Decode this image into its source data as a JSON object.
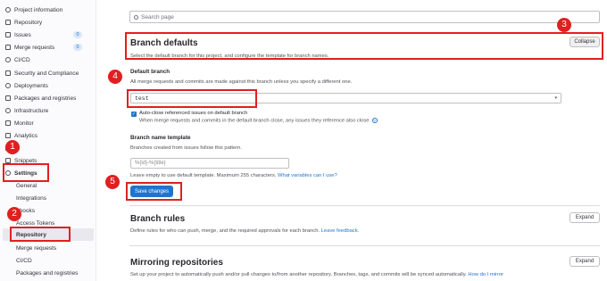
{
  "sidebar": {
    "items": [
      {
        "label": "Project information",
        "icon": "info-icon"
      },
      {
        "label": "Repository",
        "icon": "file-icon"
      },
      {
        "label": "Issues",
        "icon": "issues-icon",
        "count": "0"
      },
      {
        "label": "Merge requests",
        "icon": "merge-request-icon",
        "count": "0"
      },
      {
        "label": "CI/CD",
        "icon": "rocket-icon"
      },
      {
        "label": "Security and Compliance",
        "icon": "shield-icon"
      },
      {
        "label": "Deployments",
        "icon": "deployments-icon"
      },
      {
        "label": "Packages and registries",
        "icon": "package-icon"
      },
      {
        "label": "Infrastructure",
        "icon": "cloud-icon"
      },
      {
        "label": "Monitor",
        "icon": "monitor-icon"
      },
      {
        "label": "Analytics",
        "icon": "chart-icon"
      },
      {
        "label": "iki",
        "icon": "book-icon"
      },
      {
        "label": "Snippets",
        "icon": "snippet-icon"
      },
      {
        "label": "Settings",
        "icon": "settings-icon"
      }
    ],
    "settings_sub": [
      "General",
      "Integrations",
      "bhooks",
      "Access Tokens",
      "Repository",
      "Merge requests",
      "CI/CD",
      "Packages and registries"
    ]
  },
  "search": {
    "placeholder": "Search page"
  },
  "branch_defaults": {
    "title": "Branch defaults",
    "desc": "Select the default branch for this project, and configure the template for branch names.",
    "collapse_label": "Collapse",
    "default_branch_label": "Default branch",
    "default_branch_desc": "All merge requests and commits are made against this branch unless you specify a different one.",
    "default_branch_value": "test",
    "auto_close_label": "Auto-close referenced issues on default branch",
    "auto_close_desc": "When merge requests and commits in the default branch close, any issues they reference also close.",
    "template_label": "Branch name template",
    "template_desc": "Branches created from issues follow this pattern.",
    "template_placeholder": "%{id}-%{title}",
    "template_help": "Leave empty to use default template. Maximum 255 characters.",
    "template_help_link": "What variables can I use?",
    "save_label": "Save changes"
  },
  "branch_rules": {
    "title": "Branch rules",
    "desc": "Define rules for who can push, merge, and the required approvals for each branch.",
    "desc_link": "Leave feedback.",
    "expand_label": "Expand"
  },
  "mirroring": {
    "title": "Mirroring repositories",
    "desc": "Set up your project to automatically push and/or pull changes to/from another repository. Branches, tags, and commits will be synced automatically.",
    "desc_link": "How do I mirror",
    "expand_label": "Expand"
  },
  "annotations": [
    "1",
    "2",
    "3",
    "4",
    "5"
  ],
  "colors": {
    "accent": "#1f75cb",
    "annotation": "#e02020"
  }
}
